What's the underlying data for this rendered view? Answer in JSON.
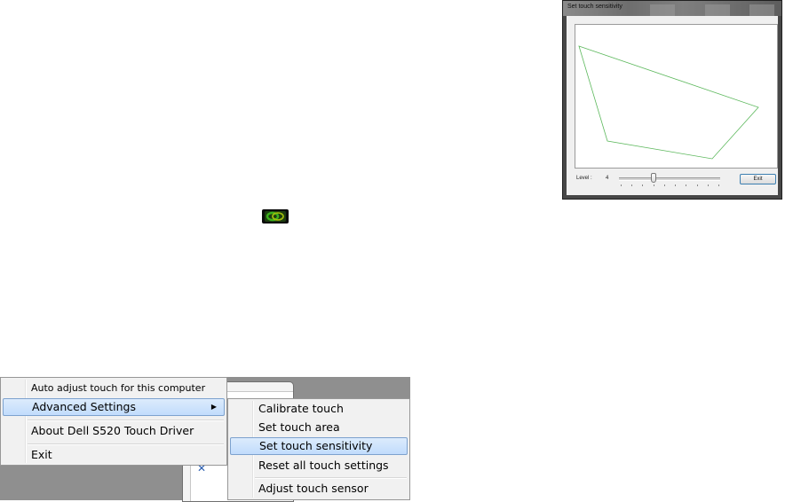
{
  "dialog": {
    "title": "Set touch sensitivity",
    "level_label": "Level :",
    "level_value": "4",
    "level_slider": {
      "value": 4,
      "min": 1,
      "max": 10
    },
    "exit_label": "Exit",
    "polygon_color": "#5cb85c"
  },
  "tray": {
    "icon": "link-icon",
    "colors": {
      "ring": "#3cb01c",
      "accent": "#f0d000"
    }
  },
  "main_menu": {
    "items": [
      {
        "label": "Auto adjust touch for this computer"
      },
      {
        "label": "Advanced Settings",
        "has_submenu": true
      },
      {
        "label": "About Dell S520 Touch Driver"
      },
      {
        "label": "Exit"
      }
    ]
  },
  "sub_menu": {
    "items": [
      {
        "label": "Calibrate touch"
      },
      {
        "label": "Set touch area"
      },
      {
        "label": "Set touch sensitivity"
      },
      {
        "label": "Reset all touch settings"
      },
      {
        "label": "Adjust touch sensor"
      }
    ]
  },
  "colors": {
    "menu_highlight": "#c1dcfc",
    "menu_highlight_border": "#7da2ce",
    "menu_background": "#f1f1f1"
  }
}
